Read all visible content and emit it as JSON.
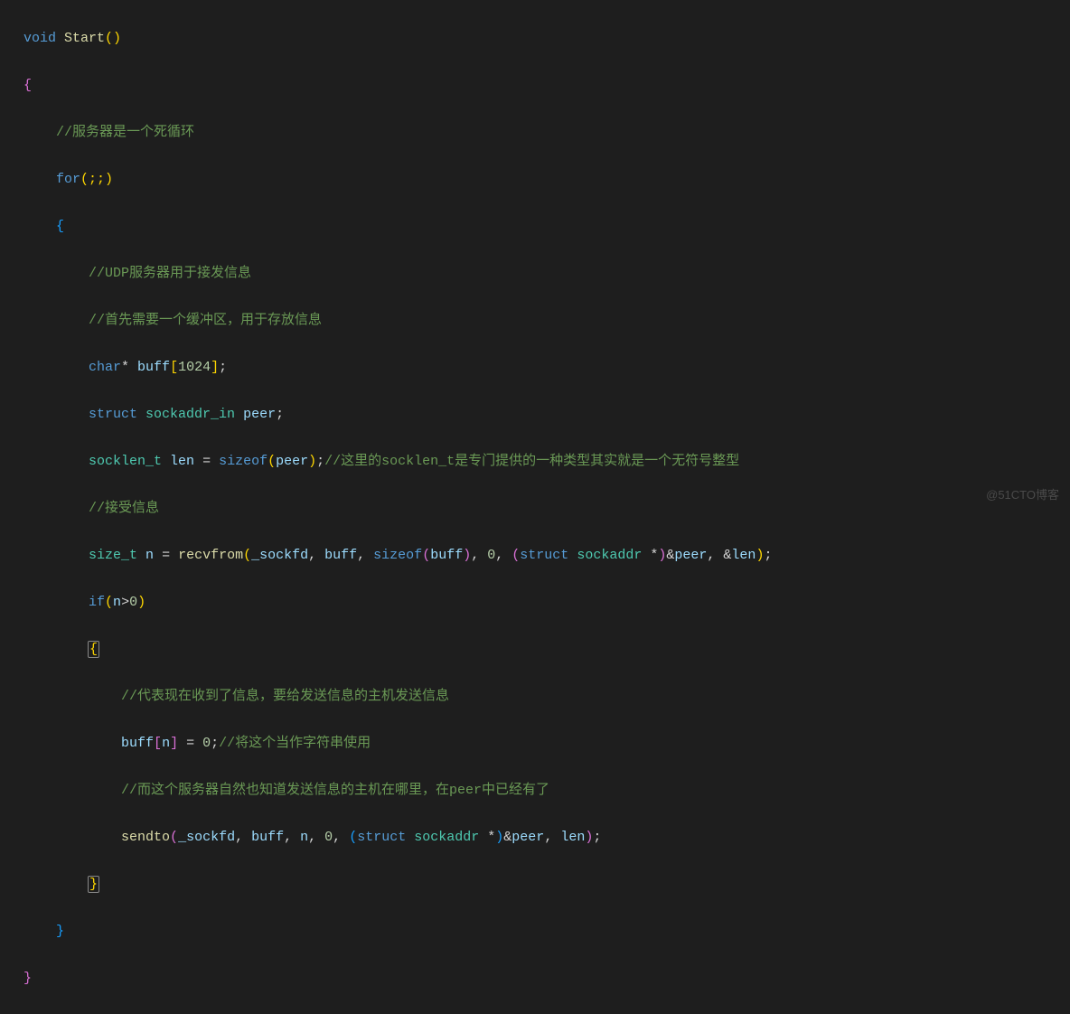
{
  "watermark": "@51CTO博客",
  "code": {
    "l01": {
      "t1": "void",
      "t2": " ",
      "t3": "Start",
      "t4": "()"
    },
    "l02": {
      "t1": "{"
    },
    "l03": {
      "t1": "    ",
      "t2": "//服务器是一个死循环"
    },
    "l04": {
      "t1": "    ",
      "t2": "for",
      "t3": "(;;)"
    },
    "l05": {
      "t1": "    ",
      "t2": "{"
    },
    "l06": {
      "t1": "        ",
      "t2": "//UDP服务器用于接发信息"
    },
    "l07": {
      "t1": "        ",
      "t2": "//首先需要一个缓冲区，用于存放信息"
    },
    "l08": {
      "t1": "        ",
      "t2": "char",
      "t3": "* ",
      "t4": "buff",
      "t5": "[",
      "t6": "1024",
      "t7": "]",
      "t8": ";"
    },
    "l09": {
      "t1": "        ",
      "t2": "struct",
      "t3": " ",
      "t4": "sockaddr_in",
      "t5": " ",
      "t6": "peer",
      "t7": ";"
    },
    "l10": {
      "t1": "        ",
      "t2": "socklen_t",
      "t3": " ",
      "t4": "len",
      "t5": " = ",
      "t6": "sizeof",
      "t7": "(",
      "t8": "peer",
      "t9": ")",
      "t10": ";",
      "t11": "//这里的socklen_t是专门提供的一种类型其实就是一个无符号整型"
    },
    "l11": {
      "t1": "        ",
      "t2": "//接受信息"
    },
    "l12": {
      "t1": "        ",
      "t2": "size_t",
      "t3": " ",
      "t4": "n",
      "t5": " = ",
      "t6": "recvfrom",
      "t7": "(",
      "t8": "_sockfd",
      "t9": ", ",
      "t10": "buff",
      "t11": ", ",
      "t12": "sizeof",
      "t13": "(",
      "t14": "buff",
      "t15": ")",
      "t16": ", ",
      "t17": "0",
      "t18": ", ",
      "t19": "(",
      "t20": "struct",
      "t21": " ",
      "t22": "sockaddr",
      "t23": " *",
      "t24": ")",
      "t25": "&",
      "t26": "peer",
      "t27": ", &",
      "t28": "len",
      "t29": ")",
      "t30": ";"
    },
    "l13": {
      "t1": "        ",
      "t2": "if",
      "t3": "(",
      "t4": "n",
      "t5": ">",
      "t6": "0",
      "t7": ")"
    },
    "l14": {
      "t1": "        ",
      "t2": "{"
    },
    "l15": {
      "t1": "            ",
      "t2": "//代表现在收到了信息，要给发送信息的主机发送信息"
    },
    "l16": {
      "t1": "            ",
      "t2": "buff",
      "t3": "[",
      "t4": "n",
      "t5": "]",
      "t6": " = ",
      "t7": "0",
      "t8": ";",
      "t9": "//将这个当作字符串使用"
    },
    "l17": {
      "t1": "            ",
      "t2": "//而这个服务器自然也知道发送信息的主机在哪里，在peer中已经有了"
    },
    "l18": {
      "t1": "            ",
      "t2": "sendto",
      "t3": "(",
      "t4": "_sockfd",
      "t5": ", ",
      "t6": "buff",
      "t7": ", ",
      "t8": "n",
      "t9": ", ",
      "t10": "0",
      "t11": ", ",
      "t12": "(",
      "t13": "struct",
      "t14": " ",
      "t15": "sockaddr",
      "t16": " *",
      "t17": ")",
      "t18": "&",
      "t19": "peer",
      "t20": ", ",
      "t21": "len",
      "t22": ")",
      "t23": ";"
    },
    "l19": {
      "t1": "        ",
      "t2": "}"
    },
    "l20": {
      "t1": "    ",
      "t2": "}"
    },
    "l21": {
      "t1": "}"
    }
  }
}
